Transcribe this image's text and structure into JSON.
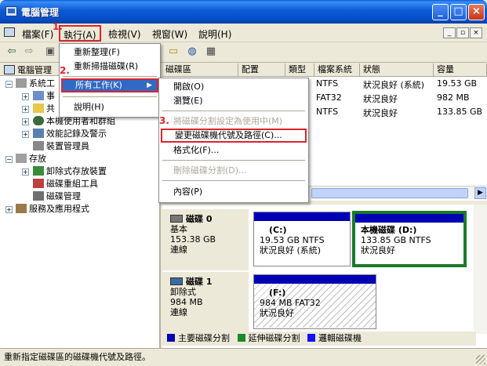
{
  "window": {
    "title": "電腦管理"
  },
  "menubar": {
    "items": [
      "檔案(F)",
      "執行(A)",
      "檢視(V)",
      "視窗(W)",
      "說明(H)"
    ],
    "mdi_buttons": [
      "_",
      "▫",
      "×"
    ]
  },
  "steps": {
    "s1": "1.",
    "s2": "2.",
    "s3": "3."
  },
  "action_menu": {
    "items": [
      "重新整理(F)",
      "重新掃描磁碟(R)",
      "所有工作(K)",
      "說明(H)"
    ]
  },
  "submenu": {
    "items": [
      "開啟(O)",
      "瀏覽(E)",
      "將磁碟分割設定為使用中(M)",
      "變更磁碟機代號及路徑(C)...",
      "格式化(F)...",
      "刪除磁碟分割(D)...",
      "內容(P)"
    ]
  },
  "tree": {
    "header": "電腦管理",
    "nodes": [
      "系統工",
      "事",
      "共",
      "本機使用者和群組",
      "效能記錄及警示",
      "裝置管理員",
      "存放",
      "卸除式存放裝置",
      "磁碟重組工具",
      "磁碟管理",
      "服務及應用程式"
    ]
  },
  "volume_list": {
    "columns": [
      "磁碟區",
      "配置",
      "類型",
      "檔案系統",
      "狀態",
      "容量"
    ],
    "rows": [
      {
        "fs": "NTFS",
        "status": "狀況良好 (系統)",
        "capacity": "19.53 GB"
      },
      {
        "fs": "FAT32",
        "status": "狀況良好",
        "capacity": "982 MB"
      },
      {
        "fs": "NTFS",
        "status": "狀況良好",
        "capacity": "133.85 GB"
      }
    ]
  },
  "disks": [
    {
      "name": "磁碟 0",
      "type": "基本",
      "size": "153.38 GB",
      "state": "連線",
      "partitions": [
        {
          "label": "(C:)",
          "detail": "19.53 GB NTFS",
          "status": "狀況良好 (系統)"
        },
        {
          "label": "本機磁碟 (D:)",
          "detail": "133.85 GB NTFS",
          "status": "狀況良好"
        }
      ]
    },
    {
      "name": "磁碟 1",
      "type": "卸除式",
      "size": "984 MB",
      "state": "連線",
      "partitions": [
        {
          "label": "(F:)",
          "detail": "984 MB FAT32",
          "status": "狀況良好"
        }
      ]
    }
  ],
  "legend": [
    "主要磁碟分割",
    "延伸磁碟分割",
    "邏輯磁碟機"
  ],
  "colors": {
    "primary": "#0000b4",
    "extended": "#1a8a2a",
    "logical": "#1010ff",
    "highlight": "#316ac5",
    "step_red": "#d8262b"
  },
  "statusbar": {
    "text": "重新指定磁碟區的磁碟機代號及路徑。"
  }
}
